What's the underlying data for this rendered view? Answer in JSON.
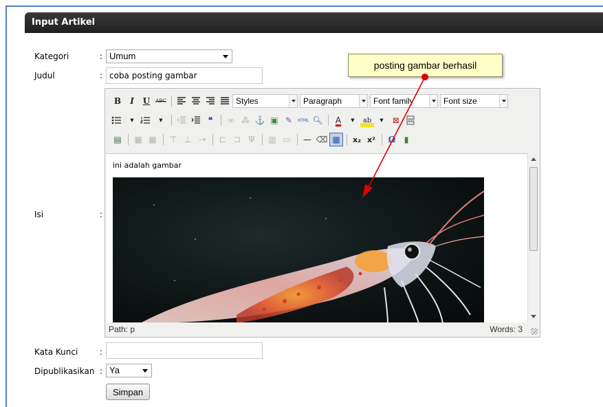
{
  "panel": {
    "title": "Input Artikel"
  },
  "form": {
    "kategori": {
      "label": "Kategori",
      "colon": ":",
      "value": "Umum"
    },
    "judul": {
      "label": "Judul",
      "colon": ":",
      "value": "coba posting gambar"
    },
    "isi": {
      "label": "Isi",
      "colon": ":"
    },
    "kata_kunci": {
      "label": "Kata Kunci",
      "colon": ":",
      "value": ""
    },
    "dipublikasikan": {
      "label": "Dipublikasikan",
      "colon": ":",
      "value": "Ya"
    },
    "submit_label": "Simpan"
  },
  "editor": {
    "toolbar": {
      "bold": "B",
      "italic": "I",
      "underline": "U",
      "strike": "ABC",
      "styles": "Styles",
      "format": "Paragraph",
      "font_family": "Font family",
      "font_size": "Font size",
      "html": "HTML"
    },
    "content_text": "ini adalah gambar",
    "status_path": "Path: p",
    "status_words": "Words: 3"
  },
  "annotation": {
    "text": "posting gambar berhasil",
    "color": "#e00000"
  },
  "colors": {
    "header": "#2b2b2b",
    "frame": "#4f81bd",
    "callout": "#ffffc8"
  }
}
